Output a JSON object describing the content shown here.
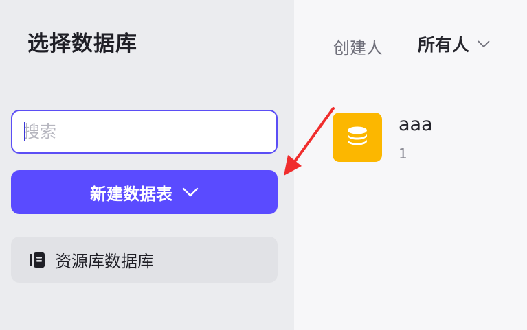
{
  "sidebar": {
    "title": "选择数据库",
    "search": {
      "placeholder": "搜索",
      "value": ""
    },
    "new_table_button": {
      "label": "新建数据表"
    },
    "resource_item": {
      "label": "资源库数据库",
      "icon": "book-icon"
    }
  },
  "main": {
    "filter": {
      "label": "创建人",
      "selected": "所有人",
      "icon": "chevron-down-icon"
    },
    "databases": [
      {
        "name": "aaa",
        "count": "1",
        "icon": "database-icon",
        "color": "#fcb700"
      }
    ]
  },
  "colors": {
    "accent": "#5a4bff",
    "annotation_arrow": "#f02d2d"
  }
}
